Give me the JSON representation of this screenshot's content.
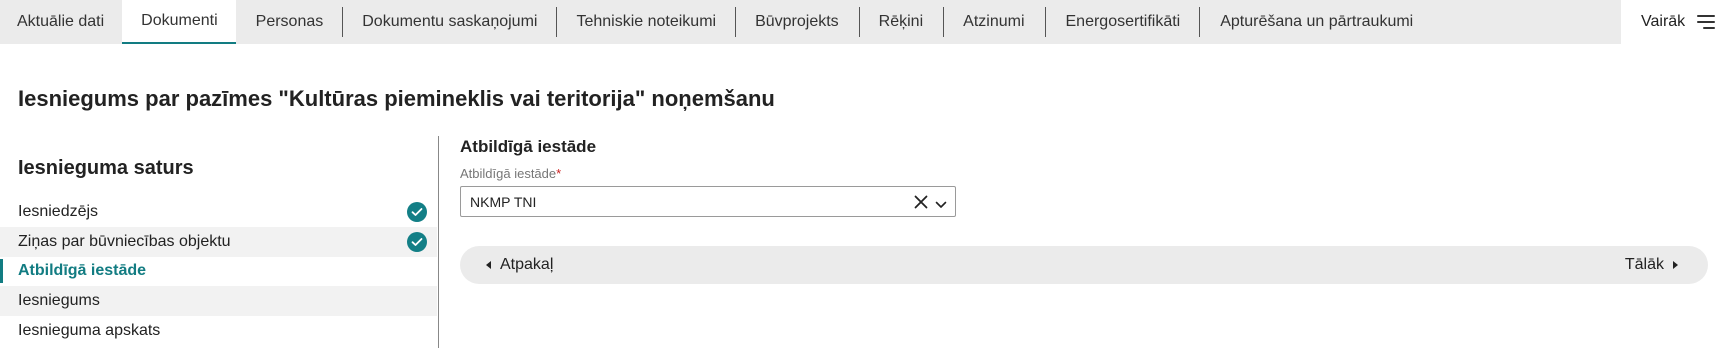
{
  "tabs": [
    {
      "label": "Aktuālie dati",
      "active": false
    },
    {
      "label": "Dokumenti",
      "active": true
    },
    {
      "label": "Personas",
      "active": false
    },
    {
      "label": "Dokumentu saskaņojumi",
      "active": false
    },
    {
      "label": "Tehniskie noteikumi",
      "active": false
    },
    {
      "label": "Būvprojekts",
      "active": false
    },
    {
      "label": "Rēķini",
      "active": false
    },
    {
      "label": "Atzinumi",
      "active": false
    },
    {
      "label": "Energosertifikāti",
      "active": false
    },
    {
      "label": "Apturēšana un pārtraukumi",
      "active": false
    }
  ],
  "more": {
    "label": "Vairāk",
    "icon": "menu-icon"
  },
  "page": {
    "title": "Iesniegums par pazīmes \"Kultūras piemineklis vai teritorija\" noņemšanu"
  },
  "steps": {
    "title": "Iesnieguma saturs",
    "items": [
      {
        "label": "Iesniedzējs",
        "completed": true,
        "current": false
      },
      {
        "label": "Ziņas par būvniecības objektu",
        "completed": true,
        "current": false
      },
      {
        "label": "Atbildīgā iestāde",
        "completed": false,
        "current": true
      },
      {
        "label": "Iesniegums",
        "completed": false,
        "current": false
      },
      {
        "label": "Iesnieguma apskats",
        "completed": false,
        "current": false
      }
    ]
  },
  "form": {
    "section_title": "Atbildīgā iestāde",
    "field_label": "Atbildīgā iestāde",
    "required_marker": "*",
    "field_value": "NKMP TNI"
  },
  "nav": {
    "back_label": "Atpakaļ",
    "next_label": "Tālāk"
  },
  "colors": {
    "accent": "#127c82",
    "check": "#137f86",
    "tabbar": "#ebebeb",
    "required": "#cc1f1f"
  }
}
